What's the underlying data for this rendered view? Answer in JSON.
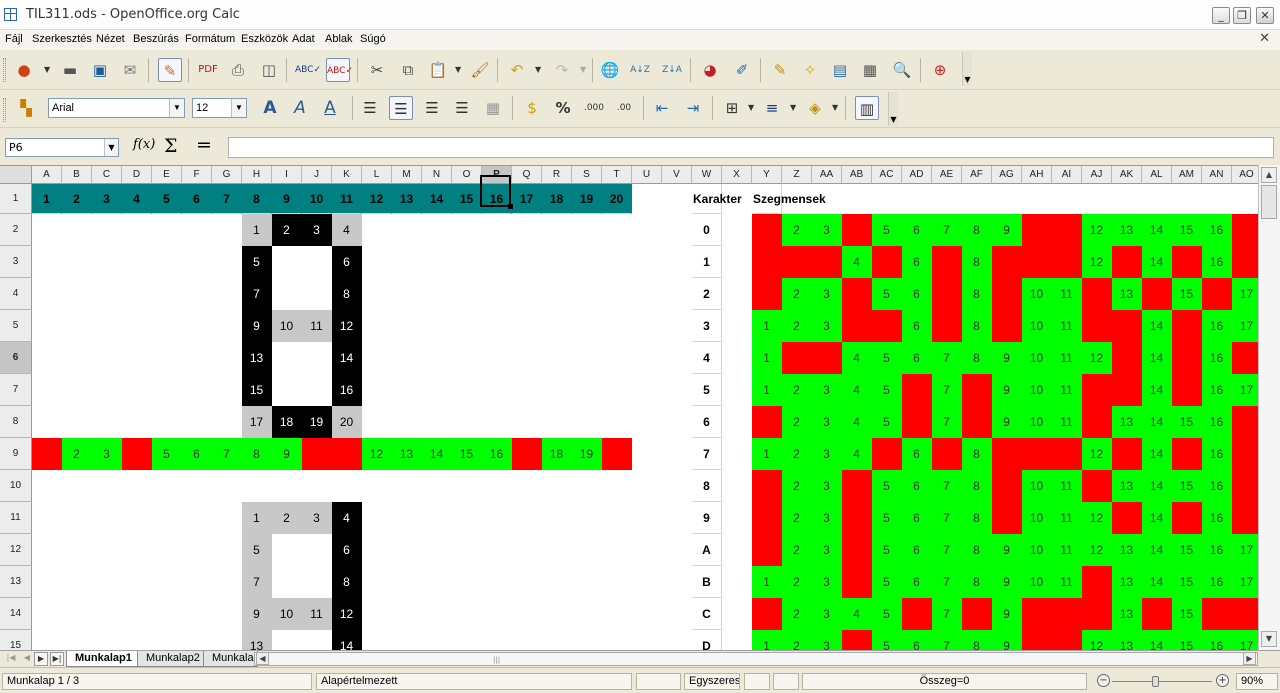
{
  "window": {
    "title": "TIL311.ods - OpenOffice.org Calc"
  },
  "menu": [
    "Fájl",
    "Szerkesztés",
    "Nézet",
    "Beszúrás",
    "Formátum",
    "Eszközök",
    "Adat",
    "Ablak",
    "Súgó"
  ],
  "format": {
    "font_name": "Arial",
    "font_size": "12"
  },
  "namebox": {
    "value": "P6"
  },
  "columns": [
    "A",
    "B",
    "C",
    "D",
    "E",
    "F",
    "G",
    "H",
    "I",
    "J",
    "K",
    "L",
    "M",
    "N",
    "O",
    "P",
    "Q",
    "R",
    "S",
    "T",
    "U",
    "V",
    "W",
    "X",
    "Y",
    "Z",
    "AA",
    "AB",
    "AC",
    "AD",
    "AE",
    "AF",
    "AG",
    "AH",
    "AI",
    "AJ",
    "AK",
    "AL",
    "AM",
    "AN",
    "AO"
  ],
  "active_col": "P",
  "active_row": "6",
  "rows": [
    "1",
    "2",
    "3",
    "4",
    "5",
    "6",
    "7",
    "8",
    "9",
    "10",
    "11",
    "12",
    "13",
    "14",
    "15"
  ],
  "header_row": {
    "numbers": [
      "1",
      "2",
      "3",
      "4",
      "5",
      "6",
      "7",
      "8",
      "9",
      "10",
      "11",
      "12",
      "13",
      "14",
      "15",
      "16",
      "17",
      "18",
      "19",
      "20"
    ],
    "karakter_label": "Karakter",
    "szegmensek_label": "Szegmensek",
    "bg_color": "#008080"
  },
  "characters": [
    "0",
    "1",
    "2",
    "3",
    "4",
    "5",
    "6",
    "7",
    "8",
    "9",
    "A",
    "B",
    "C",
    "D"
  ],
  "segment_rows": [
    "R23R5678RRR2345R",
    "RRR4R6R8RRR2R4R6",
    "R23R56R8R01R3R5R7",
    "123RR6R8R01RR4R67",
    "1RR4567890112R4R6",
    "12345R7R9011RR4R67",
    "R2345R7R9011R3456",
    "12345R7R9011R3456"
  ],
  "segment_grid": [
    [
      "R",
      "2",
      "3",
      "R",
      "5",
      "6",
      "7",
      "8",
      "9",
      "R",
      "R",
      "12",
      "13",
      "14",
      "15",
      "16",
      "R"
    ],
    [
      "R",
      "R",
      "R",
      "4",
      "R",
      "6",
      "R",
      "8",
      "R",
      "R",
      "R",
      "12",
      "R",
      "14",
      "R",
      "16",
      "R"
    ],
    [
      "R",
      "2",
      "3",
      "R",
      "5",
      "6",
      "R",
      "8",
      "R",
      "10",
      "11",
      "R",
      "13",
      "R",
      "15",
      "R",
      "17"
    ],
    [
      "1",
      "2",
      "3",
      "R",
      "R",
      "6",
      "R",
      "8",
      "R",
      "10",
      "11",
      "R",
      "R",
      "14",
      "R",
      "16",
      "17"
    ],
    [
      "1",
      "R",
      "R",
      "4",
      "5",
      "6",
      "7",
      "8",
      "9",
      "10",
      "11",
      "12",
      "R",
      "14",
      "R",
      "16",
      "R"
    ],
    [
      "1",
      "2",
      "3",
      "4",
      "5",
      "R",
      "7",
      "R",
      "9",
      "10",
      "11",
      "R",
      "R",
      "14",
      "R",
      "16",
      "17"
    ],
    [
      "R",
      "2",
      "3",
      "4",
      "5",
      "R",
      "7",
      "R",
      "9",
      "10",
      "11",
      "R",
      "13",
      "14",
      "15",
      "16",
      "R"
    ],
    [
      "1",
      "2",
      "3",
      "4",
      "R",
      "6",
      "R",
      "8",
      "R",
      "R",
      "R",
      "12",
      "R",
      "14",
      "R",
      "16",
      "R"
    ],
    [
      "R",
      "2",
      "3",
      "R",
      "5",
      "6",
      "7",
      "8",
      "R",
      "10",
      "11",
      "R",
      "13",
      "14",
      "15",
      "16",
      "R"
    ],
    [
      "R",
      "2",
      "3",
      "R",
      "5",
      "6",
      "7",
      "8",
      "R",
      "10",
      "11",
      "12",
      "R",
      "14",
      "R",
      "16",
      "R"
    ],
    [
      "R",
      "2",
      "3",
      "R",
      "5",
      "6",
      "7",
      "8",
      "9",
      "10",
      "11",
      "12",
      "13",
      "14",
      "15",
      "16",
      "17"
    ],
    [
      "1",
      "2",
      "3",
      "R",
      "5",
      "6",
      "7",
      "8",
      "9",
      "10",
      "11",
      "R",
      "13",
      "14",
      "15",
      "16",
      "17"
    ],
    [
      "R",
      "2",
      "3",
      "4",
      "5",
      "R",
      "7",
      "R",
      "9",
      "R",
      "R",
      "R",
      "13",
      "R",
      "15",
      "R",
      "R"
    ],
    [
      "1",
      "2",
      "3",
      "R",
      "5",
      "6",
      "7",
      "8",
      "9",
      "R",
      "R",
      "12",
      "13",
      "14",
      "15",
      "16",
      "17"
    ]
  ],
  "digit_top": {
    "row2": [
      "1",
      "2",
      "3",
      "4"
    ],
    "row3": [
      "5",
      "6"
    ],
    "row4": [
      "7",
      "8"
    ],
    "row5": [
      "9",
      "10",
      "11",
      "12"
    ],
    "row6": [
      "13",
      "14"
    ],
    "row7": [
      "15",
      "16"
    ],
    "row8": [
      "17",
      "18",
      "19",
      "20"
    ]
  },
  "row9_values": [
    "",
    "2",
    "3",
    "",
    "5",
    "6",
    "7",
    "8",
    "9",
    "",
    "",
    "12",
    "13",
    "14",
    "15",
    "16",
    "",
    "18",
    "19",
    ""
  ],
  "digit_bottom": {
    "row11": [
      "1",
      "2",
      "3",
      "4"
    ],
    "row12": [
      "5",
      "6"
    ],
    "row13": [
      "7",
      "8"
    ],
    "row14": [
      "9",
      "10",
      "11",
      "12"
    ],
    "row15": [
      "13",
      "14"
    ]
  },
  "colors": {
    "green": "#00ff00",
    "red": "#ff0000",
    "black": "#000000",
    "gray": "#c8c8c8",
    "teal": "#008080"
  },
  "tabs": [
    "Munkalap1",
    "Munkalap2",
    "Munkala"
  ],
  "status": {
    "sheet": "Munkalap 1 / 3",
    "style": "Alapértelmezett",
    "mode": "Egyszeres",
    "sum": "Összeg=0",
    "zoom": "90%"
  }
}
